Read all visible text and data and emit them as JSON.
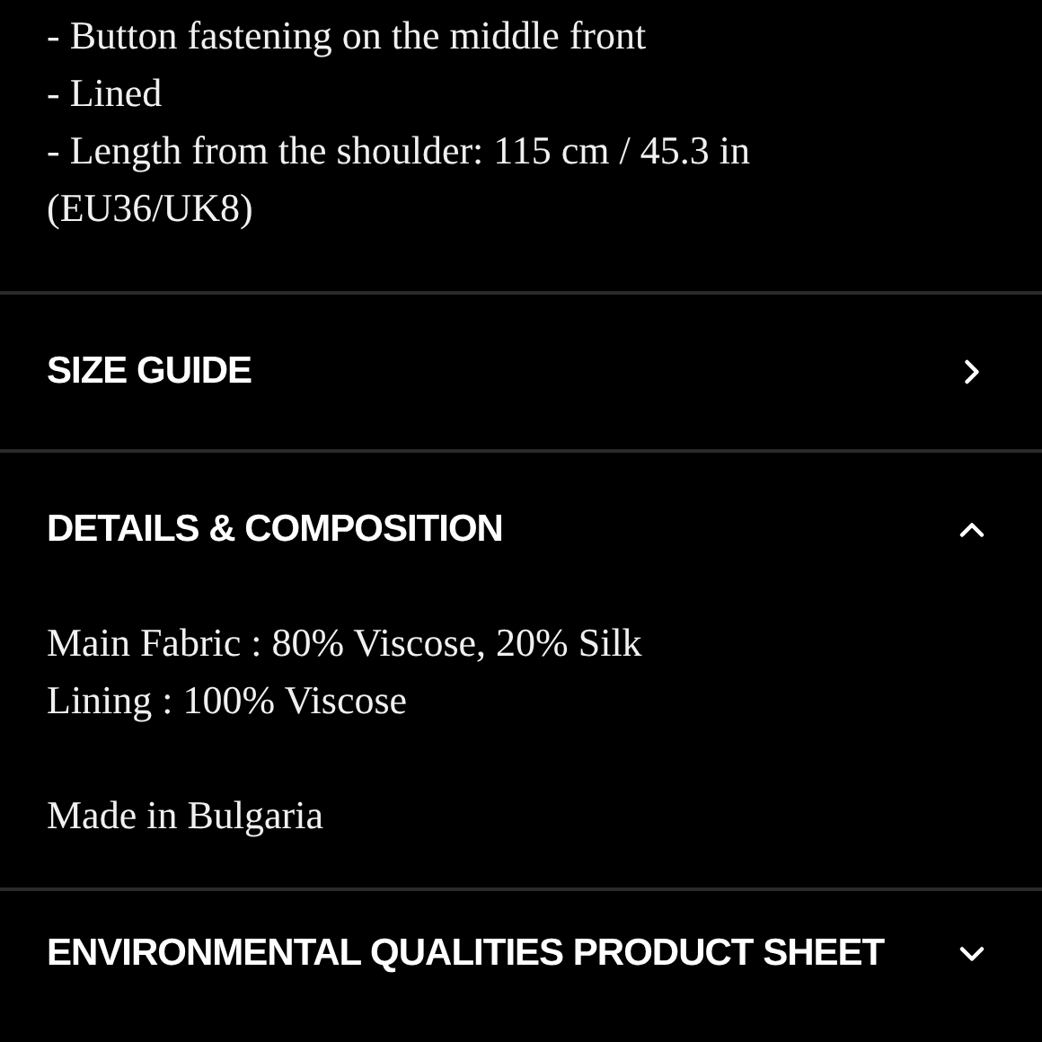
{
  "description_lines": [
    "- Button fastening on the middle front",
    "- Lined",
    "- Length from the shoulder: 115 cm / 45.3 in (EU36/UK8)"
  ],
  "sections": [
    {
      "title": "SIZE GUIDE",
      "kind": "link"
    },
    {
      "title": "DETAILS & COMPOSITION",
      "kind": "accordion",
      "expanded": true,
      "paragraphs": [
        [
          "Main Fabric : 80% Viscose, 20% Silk",
          "Lining : 100% Viscose"
        ],
        [
          "Made in Bulgaria"
        ]
      ]
    },
    {
      "title": "ENVIRONMENTAL QUALITIES PRODUCT SHEET",
      "kind": "accordion",
      "expanded": false
    }
  ]
}
